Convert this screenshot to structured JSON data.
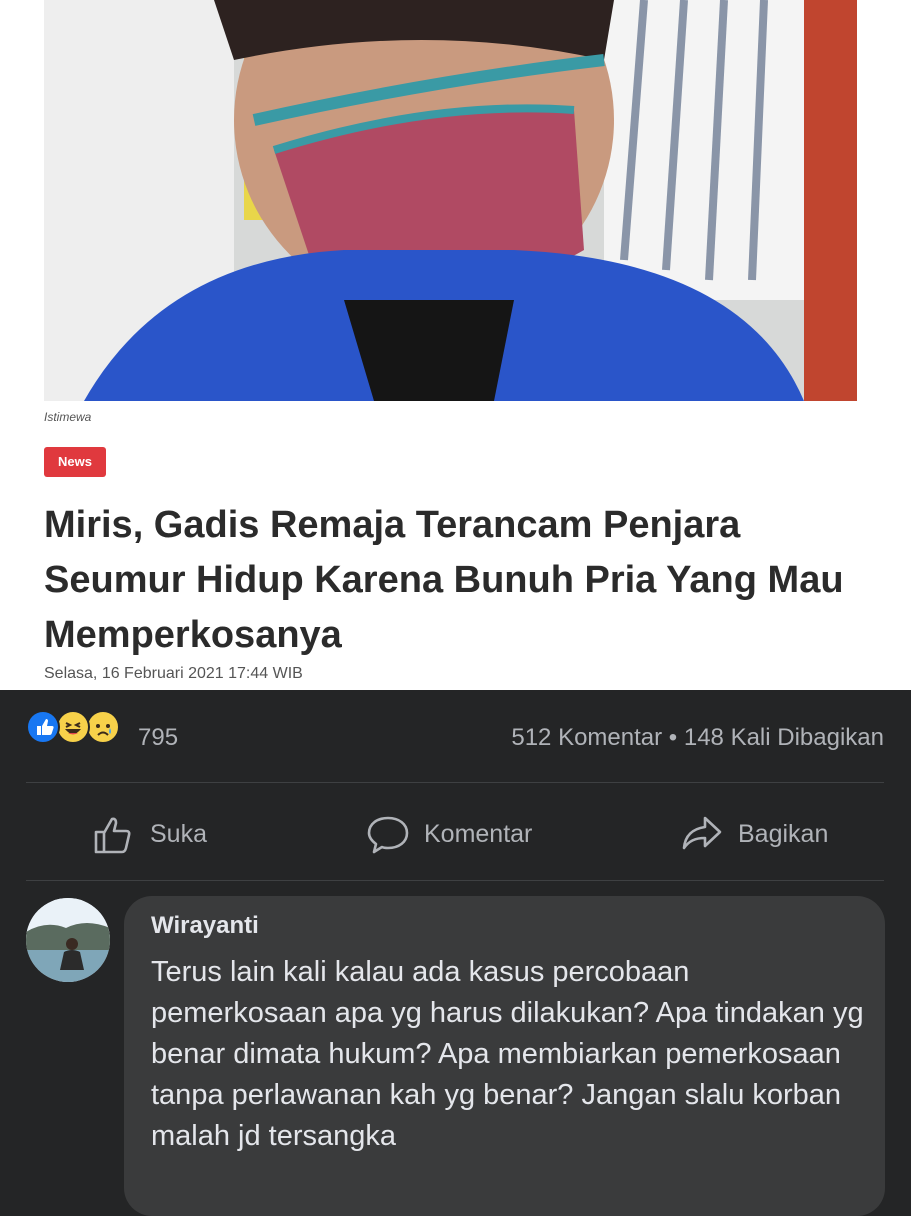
{
  "article": {
    "caption": "Istimewa",
    "category": "News",
    "headline": "Miris, Gadis Remaja Terancam Penjara Seumur Hidup Karena Bunuh Pria Yang Mau Memperkosanya",
    "date": "Selasa, 16 Februari 2021 17:44 WIB"
  },
  "post": {
    "reaction_icons": [
      "like-icon",
      "haha-icon",
      "sad-icon"
    ],
    "reaction_count": "795",
    "stats": "512 Komentar • 148 Kali Dibagikan"
  },
  "actions": {
    "like": "Suka",
    "comment": "Komentar",
    "share": "Bagikan"
  },
  "comment": {
    "author": "Wirayanti",
    "text": "Terus lain kali kalau ada kasus percobaan pemerkosaan apa yg harus dilakukan? Apa tindakan yg benar dimata hukum? Apa membiarkan pemerkosaan tanpa perlawanan kah yg benar? Jangan slalu korban malah jd tersangka"
  },
  "colors": {
    "background": "#242526",
    "comment_bubble": "#3a3b3c",
    "muted_text": "#b0b3b8",
    "news_badge": "#e0393e",
    "like_blue": "#1877f2"
  }
}
